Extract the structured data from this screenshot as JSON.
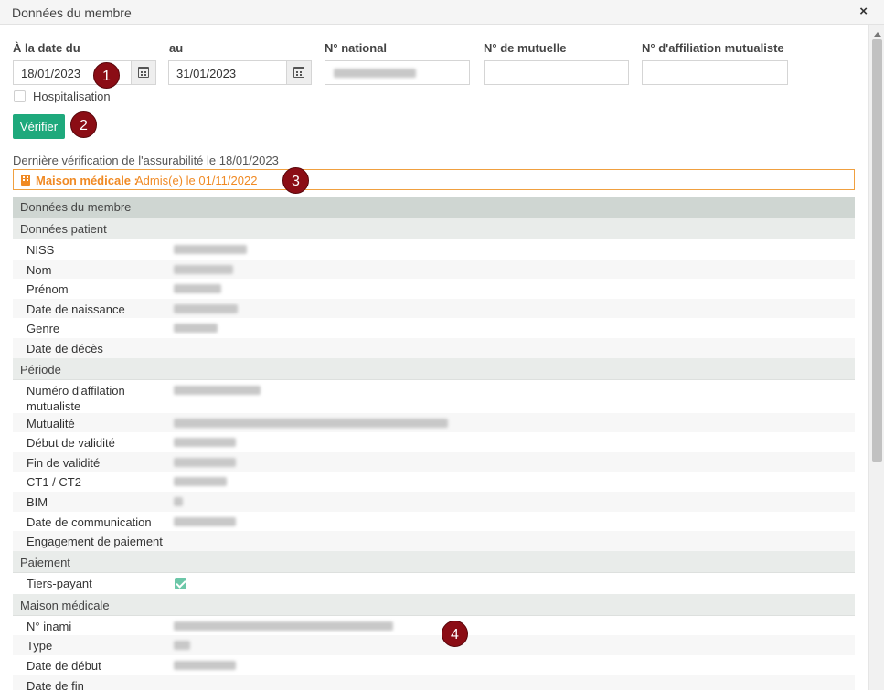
{
  "window": {
    "title": "Données du membre",
    "close_glyph": "×"
  },
  "form": {
    "from_date": {
      "label": "À la date du",
      "value": "18/01/2023"
    },
    "to_date": {
      "label": "au",
      "value": "31/01/2023"
    },
    "national_number": {
      "label": "N° national"
    },
    "mutual_number": {
      "label": "N° de mutuelle",
      "value": ""
    },
    "affiliation_number": {
      "label": "N° d'affiliation mutualiste",
      "value": ""
    },
    "hospitalisation": {
      "label": "Hospitalisation",
      "checked": false
    },
    "verify_button": "Vérifier"
  },
  "status": {
    "last_check": "Dernière vérification de l'assurabilité le 18/01/2023",
    "alert_key": "Maison médicale :",
    "alert_value": "Admis(e) le 01/11/2022"
  },
  "markers": [
    "1",
    "2",
    "3",
    "4"
  ],
  "member_table": {
    "header": "Données du membre",
    "sections": {
      "patient": {
        "title": "Données patient",
        "rows": [
          "NISS",
          "Nom",
          "Prénom",
          "Date de naissance",
          "Genre",
          "Date de décès"
        ]
      },
      "period": {
        "title": "Période",
        "rows": [
          "Numéro d'affilation mutualiste",
          "Mutualité",
          "Début de validité",
          "Fin de validité",
          "CT1 / CT2",
          "BIM",
          "Date de communication",
          "Engagement de paiement"
        ]
      },
      "payment": {
        "title": "Paiement",
        "rows": [
          "Tiers-payant"
        ],
        "tiers_payant_checked": true
      },
      "medical_house": {
        "title": "Maison médicale",
        "rows": [
          "N° inami",
          "Type",
          "Date de début",
          "Date de fin"
        ]
      }
    }
  },
  "colors": {
    "accent_green": "#1ea97c",
    "warning_orange": "#f08a24",
    "marker_red": "#8b0d15"
  }
}
